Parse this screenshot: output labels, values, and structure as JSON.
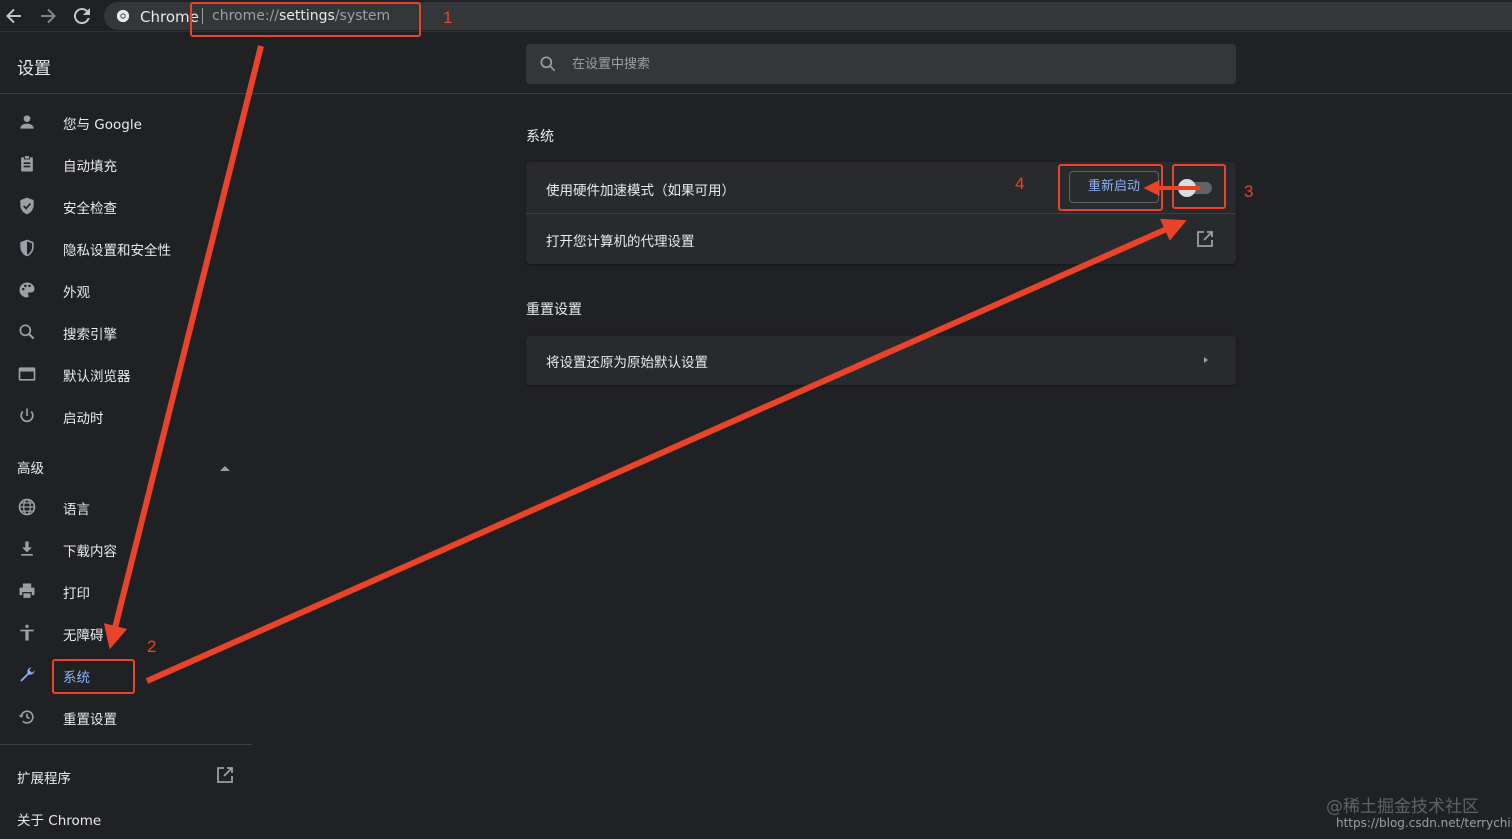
{
  "browser": {
    "site_name": "Chrome",
    "url_prefix": "chrome://",
    "url_host": "settings",
    "url_path": "/system"
  },
  "header": {
    "title": "设置",
    "search_placeholder": "在设置中搜索"
  },
  "sidebar": {
    "items": [
      {
        "label": "您与 Google",
        "icon": "person-icon"
      },
      {
        "label": "自动填充",
        "icon": "clipboard-icon"
      },
      {
        "label": "安全检查",
        "icon": "shield-check-icon"
      },
      {
        "label": "隐私设置和安全性",
        "icon": "shield-half-icon"
      },
      {
        "label": "外观",
        "icon": "palette-icon"
      },
      {
        "label": "搜索引擎",
        "icon": "search-icon"
      },
      {
        "label": "默认浏览器",
        "icon": "browser-window-icon"
      },
      {
        "label": "启动时",
        "icon": "power-icon"
      }
    ],
    "advanced_label": "高级",
    "advanced_items": [
      {
        "label": "语言",
        "icon": "globe-icon"
      },
      {
        "label": "下载内容",
        "icon": "download-icon"
      },
      {
        "label": "打印",
        "icon": "printer-icon"
      },
      {
        "label": "无障碍",
        "icon": "accessibility-icon"
      },
      {
        "label": "系统",
        "icon": "wrench-icon",
        "active": true
      },
      {
        "label": "重置设置",
        "icon": "history-icon"
      }
    ],
    "extensions_label": "扩展程序",
    "about_label": "关于 Chrome"
  },
  "main": {
    "system_section_title": "系统",
    "hw_accel_label": "使用硬件加速模式（如果可用）",
    "restart_button": "重新启动",
    "hw_accel_enabled": false,
    "proxy_label": "打开您计算机的代理设置",
    "reset_section_title": "重置设置",
    "reset_label": "将设置还原为原始默认设置"
  },
  "annotations": {
    "n1": "1",
    "n2": "2",
    "n3": "3",
    "n4": "4",
    "color": "#e9442a"
  },
  "watermark": {
    "line1": "@稀土掘金技术社区",
    "line2": "https://blog.csdn.net/terrychinaz"
  }
}
